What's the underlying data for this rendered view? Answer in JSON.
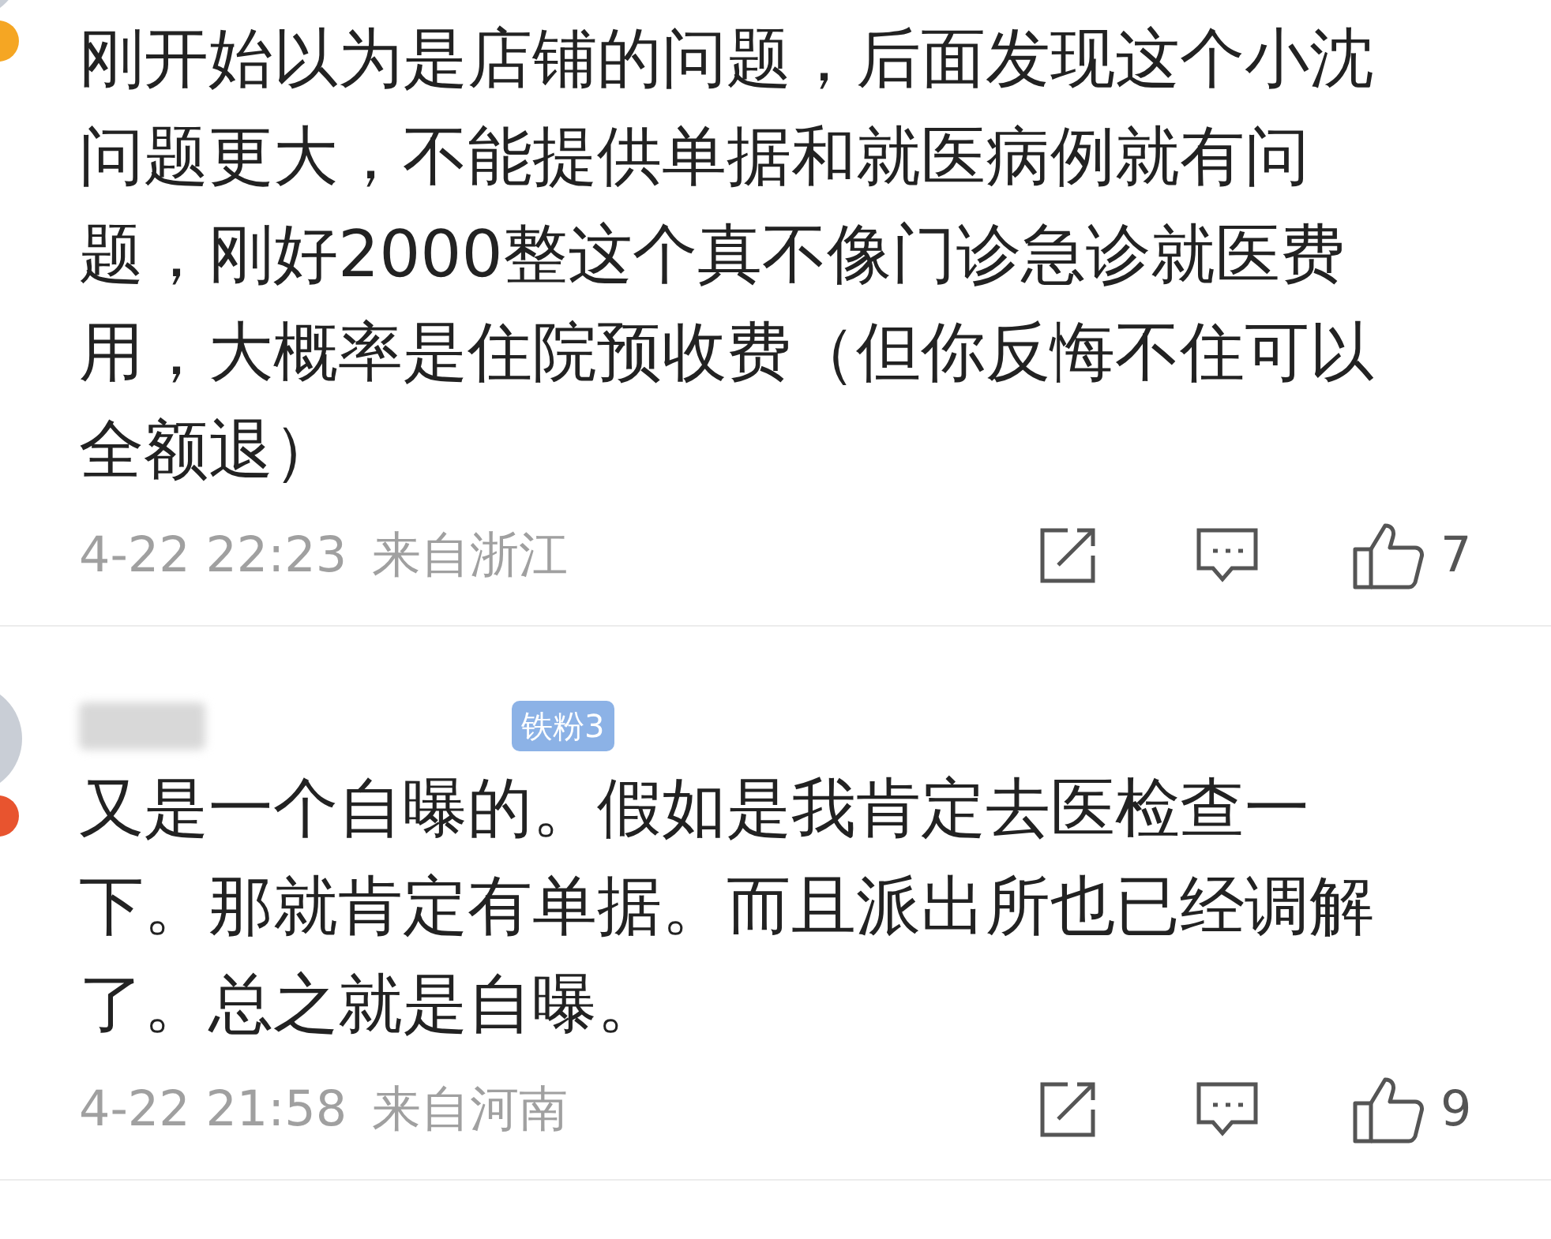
{
  "comments": [
    {
      "color": "#f5a623",
      "text": "刚开始以为是店铺的问题，后面发现这个小沈问题更大，不能提供单据和就医病例就有问题，刚好2000整这个真不像门诊急诊就医费用，大概率是住院预收费（但你反悔不住可以全额退）",
      "time": "4-22 22:23",
      "location": "来自浙江",
      "likes": "7"
    },
    {
      "color": "#e8542f",
      "fan_badge": "铁粉3",
      "text": "又是一个自曝的。假如是我肯定去医检查一下。那就肯定有单据。而且派出所也已经调解了。总之就是自曝。",
      "time": "4-22 21:58",
      "location": "来自河南",
      "likes": "9"
    }
  ]
}
